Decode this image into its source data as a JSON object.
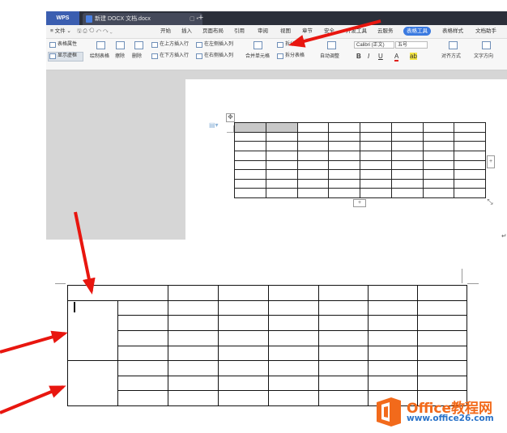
{
  "titlebar": {
    "app_label": "WPS",
    "doc_tab_title": "新建 DOCX 文档.docx",
    "doc_tab_controls": "▢ •",
    "new_tab": "+"
  },
  "menubar": {
    "file_label": "≡ 文件 ⌄",
    "items": [
      "开始",
      "插入",
      "页面布局",
      "引用",
      "审阅",
      "视图",
      "章节",
      "安全",
      "开发工具",
      "云服务",
      "表格工具",
      "表格样式",
      "文档助手"
    ],
    "active_index": 10
  },
  "ribbon": {
    "table_props": "表格属性",
    "show_gridlines": "显示虚框",
    "draw_table": "绘制表格",
    "erase": "擦除",
    "delete": "删除",
    "insert_above": "在上方插入行",
    "insert_below": "在下方插入行",
    "insert_left": "在左侧插入列",
    "insert_right": "在右侧插入列",
    "merge_cells": "合并单元格",
    "split_cells": "拆分",
    "split_table": "拆分表格",
    "auto_fit": "自动调整",
    "font_name": "Calibri (正文)",
    "font_size": "五号",
    "bold": "B",
    "italic": "I",
    "underline": "U",
    "font_color": "A",
    "align": "对齐方式",
    "text_direction": "文字方向"
  },
  "table_controls": {
    "move_handle": "✥",
    "add_row": "+",
    "add_col": "+",
    "resize": "⤡"
  },
  "paragraph_mark": "↵",
  "logo": {
    "title": "Office教程网",
    "url": "www.office26.com"
  },
  "colors": {
    "accent_blue": "#3b7ae0",
    "arrow_red": "#e8160f",
    "logo_orange": "#f26a1b"
  }
}
